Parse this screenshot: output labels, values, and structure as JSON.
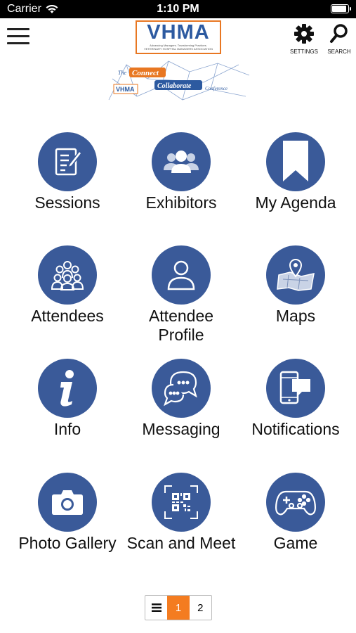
{
  "status_bar": {
    "carrier": "Carrier",
    "time": "1:10 PM",
    "battery_level": 0.95
  },
  "header": {
    "logo_text": "VHMA",
    "logo_tagline": "Advancing Managers. Transforming Practices.",
    "logo_org": "VETERINARY HOSPITAL MANAGERS ASSOCIATION",
    "banner": {
      "the": "The",
      "connect": "Connect",
      "collaborate": "Collaborate",
      "conference": "Conference",
      "mini_logo": "VHMA"
    },
    "settings_label": "SETTINGS",
    "search_label": "SEARCH"
  },
  "tiles": [
    {
      "label": "Sessions",
      "icon": "sessions-icon"
    },
    {
      "label": "Exhibitors",
      "icon": "exhibitors-icon"
    },
    {
      "label": "My Agenda",
      "icon": "bookmark-icon"
    },
    {
      "label": "Attendees",
      "icon": "attendees-icon"
    },
    {
      "label": "Attendee Profile",
      "icon": "profile-icon"
    },
    {
      "label": "Maps",
      "icon": "map-icon"
    },
    {
      "label": "Info",
      "icon": "info-icon"
    },
    {
      "label": "Messaging",
      "icon": "messaging-icon"
    },
    {
      "label": "Notifications",
      "icon": "notifications-icon"
    },
    {
      "label": "Photo Gallery",
      "icon": "camera-icon"
    },
    {
      "label": "Scan and Meet",
      "icon": "qr-scan-icon"
    },
    {
      "label": "Game",
      "icon": "gamepad-icon"
    }
  ],
  "pager": {
    "list_icon": "list-icon",
    "pages": [
      "1",
      "2"
    ],
    "active_page": "1"
  },
  "colors": {
    "circle": "#3a5a99",
    "accent": "#f47c20",
    "logo_blue": "#2d5aa0"
  }
}
